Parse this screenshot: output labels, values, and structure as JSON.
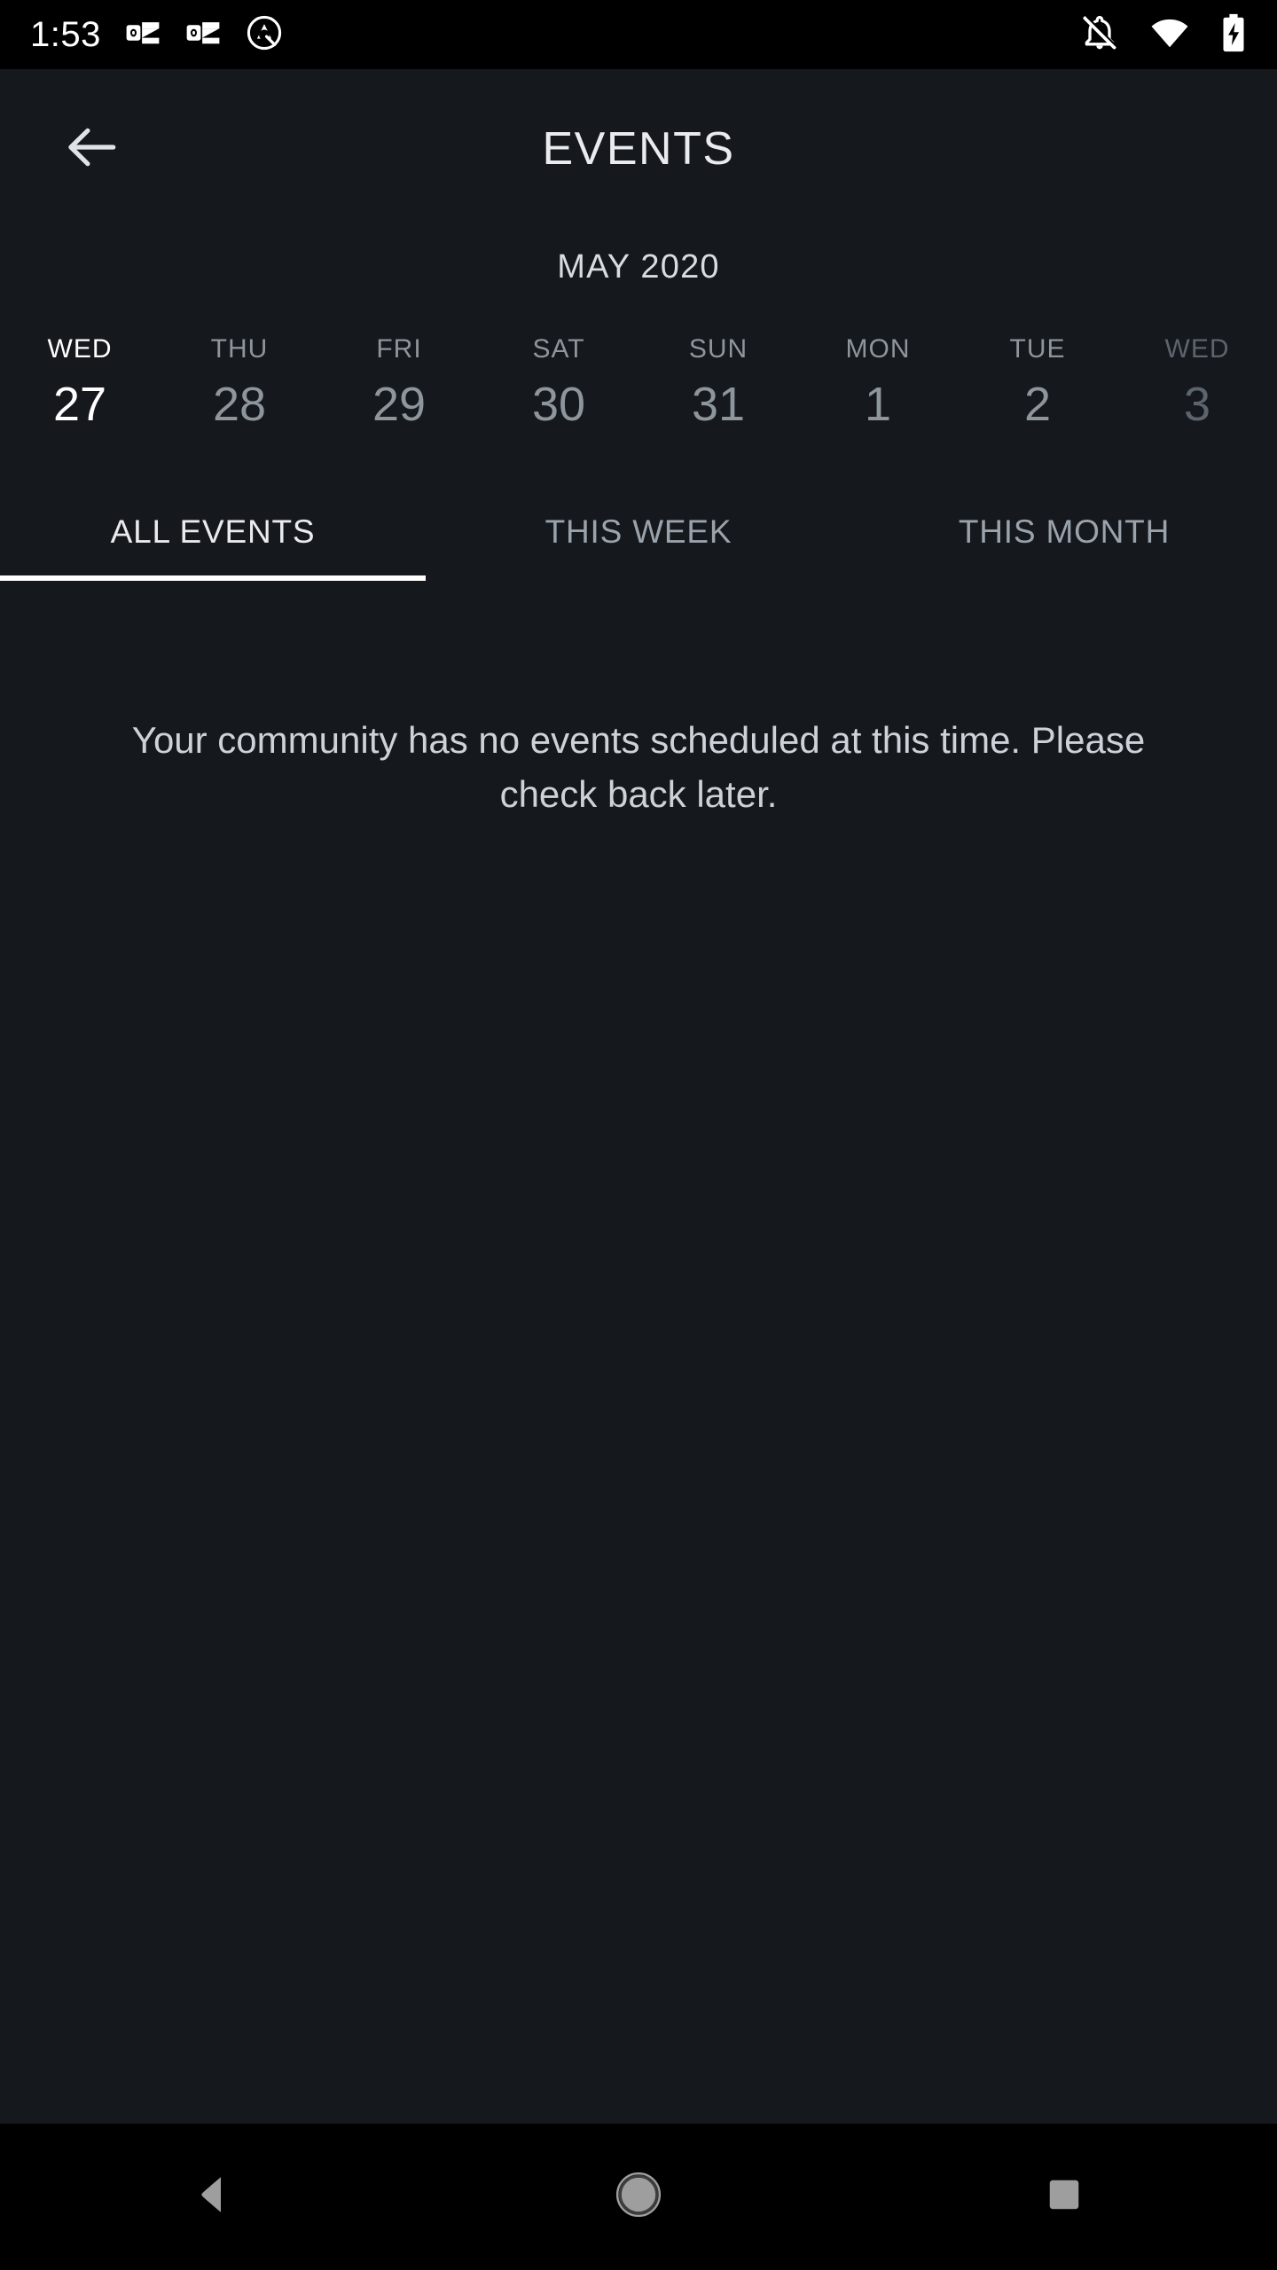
{
  "status_bar": {
    "time": "1:53",
    "left_icons": [
      "outlook-notification-icon",
      "outlook-notification-icon",
      "android-q-logo-icon"
    ],
    "right_icons": [
      "notifications-muted-icon",
      "wifi-icon",
      "battery-charging-icon"
    ],
    "background_color": "#000000",
    "icon_color": "#ffffff"
  },
  "app_bar": {
    "back_icon": "back-arrow-icon",
    "title": "EVENTS"
  },
  "calendar": {
    "month_label": "MAY 2020",
    "days": [
      {
        "dow": "WED",
        "date": "27",
        "state": "selected"
      },
      {
        "dow": "THU",
        "date": "28",
        "state": "normal"
      },
      {
        "dow": "FRI",
        "date": "29",
        "state": "normal"
      },
      {
        "dow": "SAT",
        "date": "30",
        "state": "normal"
      },
      {
        "dow": "SUN",
        "date": "31",
        "state": "normal"
      },
      {
        "dow": "MON",
        "date": "1",
        "state": "normal"
      },
      {
        "dow": "TUE",
        "date": "2",
        "state": "normal"
      },
      {
        "dow": "WED",
        "date": "3",
        "state": "faded"
      }
    ]
  },
  "tabs": {
    "items": [
      {
        "label": "ALL EVENTS",
        "active": true
      },
      {
        "label": "THIS WEEK",
        "active": false
      },
      {
        "label": "THIS MONTH",
        "active": false
      }
    ],
    "active_indicator_color": "#ffffff"
  },
  "content": {
    "empty_message": "Your community has no events scheduled at this time. Please check back later."
  },
  "nav_bar": {
    "buttons": [
      "nav-back-icon",
      "nav-home-icon",
      "nav-recents-icon"
    ],
    "background_color": "#000000",
    "icon_color": "#9e9e9e"
  },
  "theme": {
    "app_background": "#15181c",
    "primary_text": "#e9ebee",
    "secondary_text": "#8d959d",
    "muted_text": "#5c646d"
  }
}
